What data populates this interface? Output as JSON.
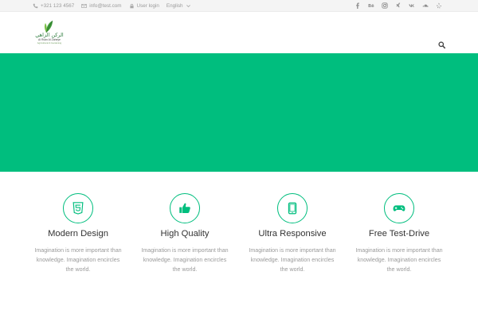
{
  "topbar": {
    "phone": "+321 123 4567",
    "email": "info@test.com",
    "login": "User login",
    "language": "English"
  },
  "logo": {
    "arabic": "الركن الزاهي",
    "english": "Al Rukn Al Zaheye",
    "tagline": "Agricultural & Gardening"
  },
  "features": [
    {
      "icon": "html5-icon",
      "title": "Modern Design",
      "text": "Imagination is more important than knowledge. Imagination encircles the world."
    },
    {
      "icon": "thumbs-up-icon",
      "title": "High Quality",
      "text": "Imagination is more important than knowledge. Imagination encircles the world."
    },
    {
      "icon": "tablet-icon",
      "title": "Ultra Responsive",
      "text": "Imagination is more important than knowledge. Imagination encircles the world."
    },
    {
      "icon": "gamepad-icon",
      "title": "Free Test-Drive",
      "text": "Imagination is more important than knowledge. Imagination encircles the world."
    }
  ],
  "colors": {
    "accent": "#00be7e",
    "topbar_bg": "#f4f4f4",
    "muted_text": "#9a9a9a"
  }
}
